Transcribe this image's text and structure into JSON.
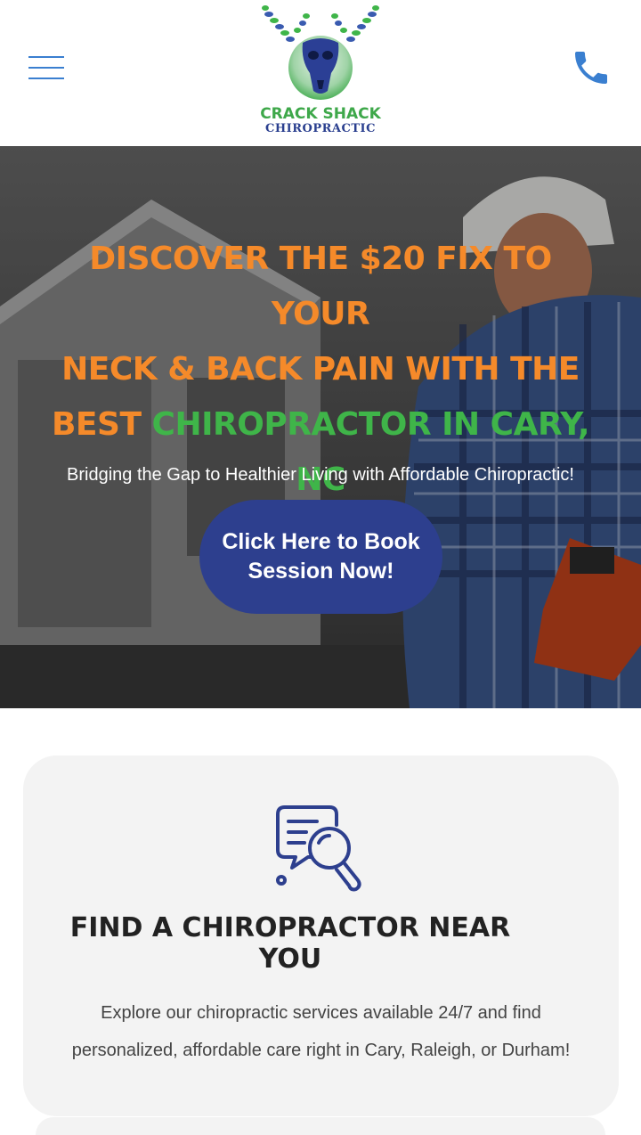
{
  "header": {
    "logo": {
      "line1": "CRACK SHACK",
      "line2": "CHIROPRACTIC"
    },
    "menu_icon": "hamburger-menu-icon",
    "phone_icon": "phone-icon"
  },
  "hero": {
    "title_parts": {
      "p1": "DISCOVER THE $20 FIX TO YOUR",
      "p2": "NECK & BACK PAIN WITH THE",
      "p3": "BEST ",
      "p4": "CHIROPRACTOR IN CARY,",
      "p5": "NC"
    },
    "subtitle": "Bridging the Gap to Healthier Living with Affordable Chiropractic!",
    "cta_line1": "Click Here to Book",
    "cta_line2": "Session Now!"
  },
  "card": {
    "icon": "search-document-icon",
    "title_line1": "FIND A CHIROPRACTOR NEAR",
    "title_line2": "YOU",
    "text": "Explore our chiropractic services available 24/7 and find personalized, affordable care right in Cary, Raleigh, or Durham!"
  },
  "colors": {
    "accent_orange": "#f58a2a",
    "accent_green": "#3fb549",
    "brand_blue": "#2d3f8e",
    "link_blue": "#3a7fd0"
  }
}
